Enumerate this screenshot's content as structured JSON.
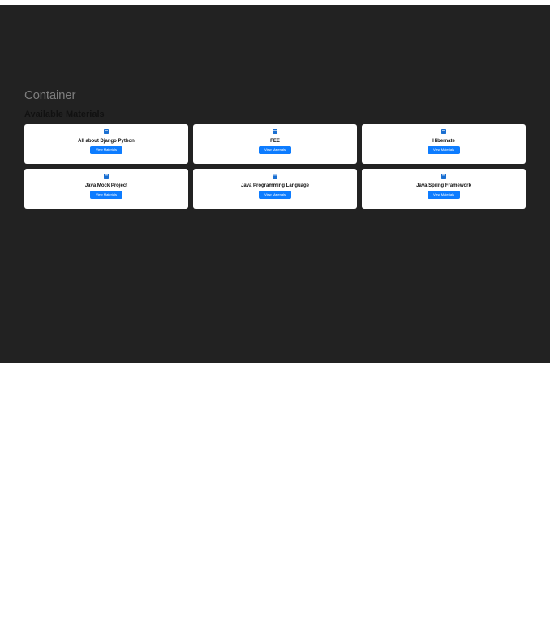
{
  "header": {
    "container_title": "Container"
  },
  "materials": {
    "heading": "Available Materials",
    "button_label": "View Materials",
    "items": [
      {
        "title": "All about Django Python"
      },
      {
        "title": "FEE"
      },
      {
        "title": "Hibernate"
      },
      {
        "title": "Java Mock Project"
      },
      {
        "title": "Java Programming Language"
      },
      {
        "title": "Java Spring Framework"
      }
    ]
  },
  "icons": {
    "card_icon": "book-icon"
  },
  "colors": {
    "panel_bg": "#222222",
    "button_bg": "#0d7cff",
    "card_bg": "#ffffff",
    "icon_color": "#1a6fd1"
  }
}
